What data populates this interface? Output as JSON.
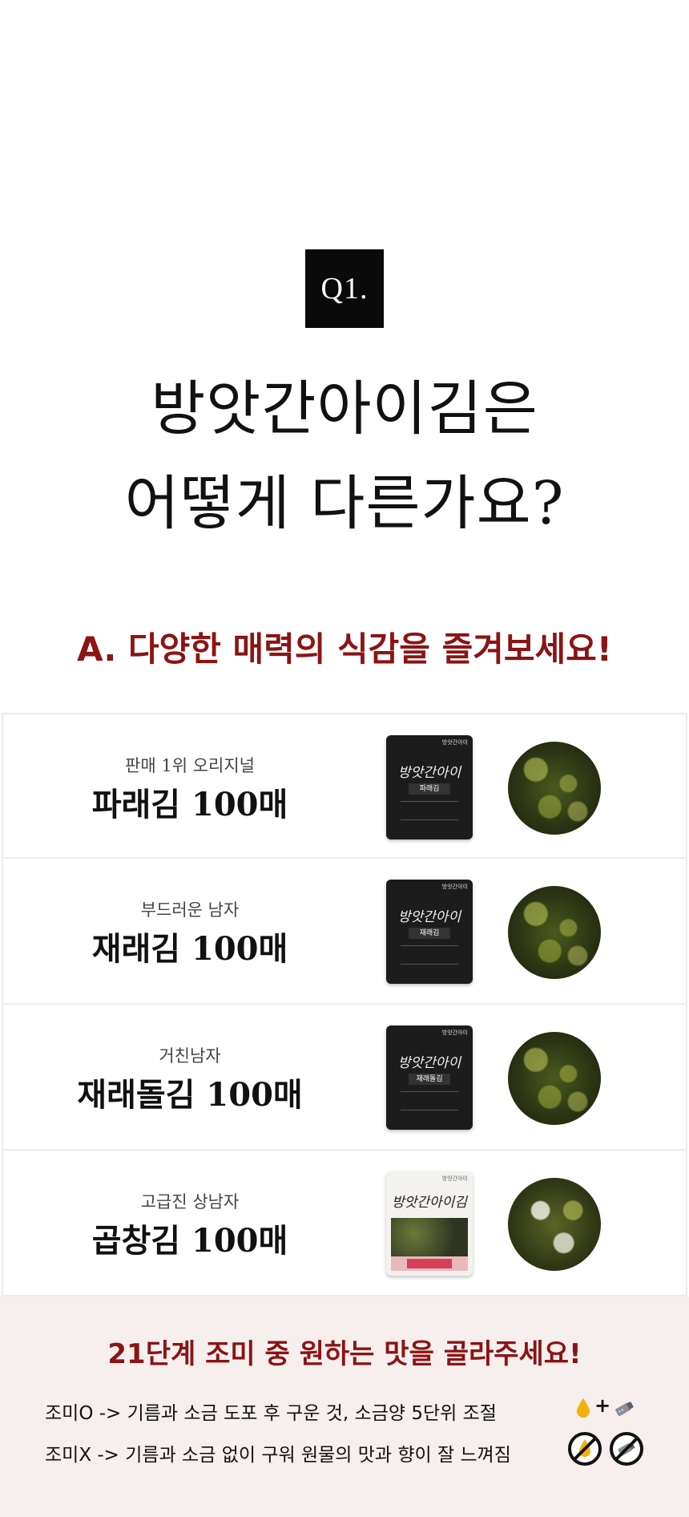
{
  "question": {
    "badge": "Q1.",
    "title_line1": "방앗간아이김은",
    "title_line2": "어떻게 다른가요?"
  },
  "answer": "A. 다양한 매력의 식감을 즐겨보세요!",
  "products": [
    {
      "subtitle": "판매 1위 오리지널",
      "name": "파래김 100매",
      "pack_label": "파래김"
    },
    {
      "subtitle": "부드러운 남자",
      "name": "재래김 100매",
      "pack_label": "재래김"
    },
    {
      "subtitle": "거친남자",
      "name": "재래돌김 100매",
      "pack_label": "재래돌김"
    },
    {
      "subtitle": "고급진 상남자",
      "name": "곱창김 100매",
      "pack_label": ""
    }
  ],
  "pack_brand": "방앗간아이",
  "pack_logo": "방앗간아이",
  "pack_logo_gim": "방앗간아이김",
  "taste": {
    "title": "21단계 조미 중 원하는 맛을 골라주세요!",
    "line_seasoned": "조미O -> 기름과 소금 도포 후 구운 것, 소금양 5단위 조절",
    "line_unseasoned": "조미X -> 기름과 소금 없이 구워 원물의 맛과 향이 잘 느껴짐",
    "plus": "+"
  },
  "colors": {
    "accent": "#8b1414",
    "badge_bg": "#0a0a0a",
    "taste_bg": "#f6efee"
  },
  "icons": [
    "oil-drop-icon",
    "salt-shaker-icon",
    "no-oil-icon",
    "no-salt-icon"
  ]
}
